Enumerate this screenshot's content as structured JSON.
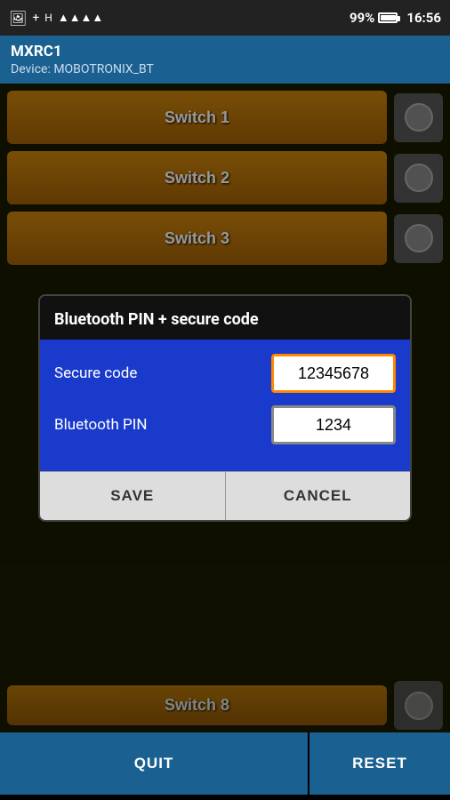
{
  "statusBar": {
    "time": "16:56",
    "battery": "99%",
    "signal": "▲▲▲▲"
  },
  "appBar": {
    "title": "MXRC1",
    "deviceLabel": "Device: MOBOTRONIX_BT"
  },
  "switches": [
    {
      "id": 1,
      "label": "Switch 1"
    },
    {
      "id": 2,
      "label": "Switch 2"
    },
    {
      "id": 3,
      "label": "Switch 3"
    }
  ],
  "switch8": {
    "label": "Switch 8"
  },
  "bottomBar": {
    "quit": "QUIT",
    "reset": "RESET"
  },
  "dialog": {
    "title": "Bluetooth PIN + secure code",
    "secureCodeLabel": "Secure code",
    "secureCodeValue": "12345678",
    "bluetoothPinLabel": "Bluetooth PIN",
    "bluetoothPinValue": "1234",
    "saveLabel": "SAVE",
    "cancelLabel": "CANCEL"
  }
}
